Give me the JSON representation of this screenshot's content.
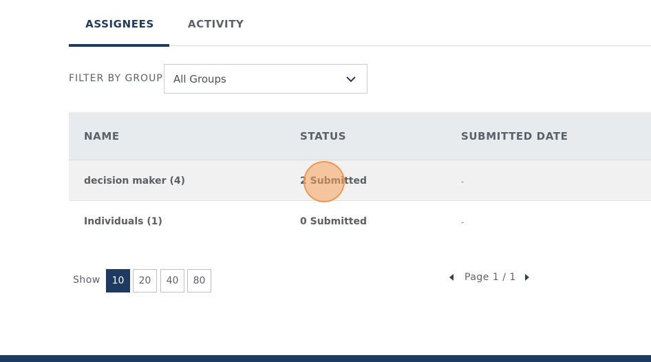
{
  "tabs": [
    {
      "label": "ASSIGNEES",
      "active": true
    },
    {
      "label": "ACTIVITY",
      "active": false
    }
  ],
  "filter": {
    "label": "FILTER BY GROUP",
    "selected": "All Groups",
    "icon": "chevron-down-icon"
  },
  "table": {
    "columns": [
      "NAME",
      "STATUS",
      "SUBMITTED DATE"
    ],
    "rows": [
      {
        "name": "decision maker (4)",
        "status": "2 Submitted",
        "date": "-"
      },
      {
        "name": "Individuals (1)",
        "status": "0 Submitted",
        "date": "-"
      }
    ]
  },
  "pagination": {
    "show_label": "Show",
    "sizes": [
      "10",
      "20",
      "40",
      "80"
    ],
    "active_size": "10",
    "page_text": "Page 1 / 1",
    "prev_icon": "caret-left-icon",
    "next_icon": "caret-right-icon"
  },
  "colors": {
    "primary": "#1f3a5f",
    "header_bg": "#e8ebee",
    "row_highlight": "#f1f1f1",
    "click_indicator": "#f5a05a"
  }
}
